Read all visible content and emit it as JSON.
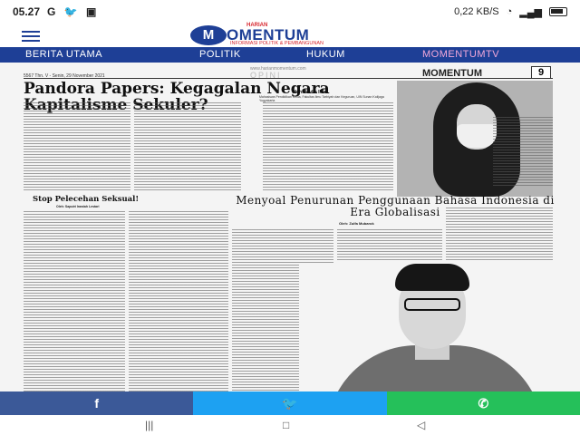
{
  "status_bar": {
    "time": "05.27",
    "app_icons": [
      "G",
      "twitter-icon",
      "app-icon"
    ],
    "speed": "0,22 KB/S",
    "battery": "battery-icon"
  },
  "header": {
    "brand_prefix": "HARIAN",
    "brand_letter": "M",
    "brand_name": "OMENTUM",
    "tagline": "INFORMASI POLITIK & PEMBANGUNAN"
  },
  "nav": {
    "items": [
      "BERITA UTAMA",
      "POLITIK",
      "HUKUM",
      "MOMENTUMTV"
    ]
  },
  "paper": {
    "edition": "5567 Thn. V - Senin, 29 November 2021",
    "website": "www.harianmomentum.com",
    "section": "OPINI",
    "mini_logo": "MOMENTUM",
    "page_number": "9",
    "headline": "Pandora Papers: Kegagalan Negara Kapitalisme Sekuler?",
    "author_top": "Oleh: Nadia Ilda",
    "author_top_desc": "Mahasiswa Pendidikan Kimia, Fakultas Ilmu Tarbiyah dan Keguruan, UIN Sunan Kalijaga Yogyakarta",
    "sub_headline": "Stop Pelecehan Seksual!",
    "sub_author": "Oleh: Saputri Irawiah Lestari",
    "headline2": "Menyoal Penurunan Penggunaan Bahasa Indonesia di Era Globalisasi",
    "author2": "Oleh: Zulfa Mubarok"
  },
  "share": {
    "facebook": "f",
    "twitter": "twitter-icon",
    "whatsapp": "whatsapp-icon"
  },
  "system_nav": {
    "recent": "|||",
    "home": "□",
    "back": "◁"
  },
  "colors": {
    "brand_blue": "#1e3f96",
    "brand_red": "#d7262d",
    "facebook": "#3b5998",
    "twitter": "#1da1f2",
    "whatsapp": "#25c05a"
  }
}
